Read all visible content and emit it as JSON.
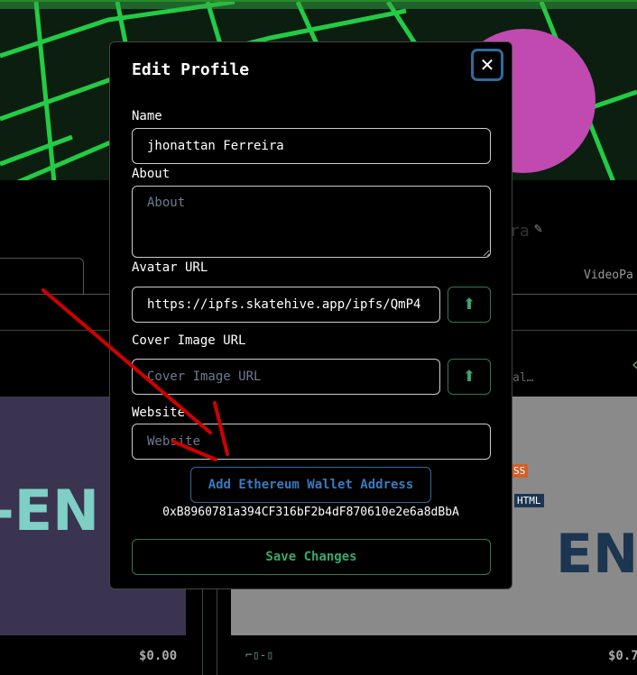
{
  "background": {
    "profile_name_fragment": "ra",
    "tab_label": "VideoPa",
    "card_snippet": "al…",
    "card1_art_text": "-EN",
    "card2_art_text": "END",
    "card2_badges": [
      "SS",
      "HTML"
    ],
    "card1_price": "$0.00",
    "card2_price": "$0.7",
    "card2_icons": "⌐▯-▯"
  },
  "modal": {
    "title": "Edit Profile",
    "close_icon": "close-icon",
    "fields": {
      "name": {
        "label": "Name",
        "value": "jhonattan Ferreira"
      },
      "about": {
        "label": "About",
        "placeholder": "About",
        "value": ""
      },
      "avatar": {
        "label": "Avatar URL",
        "value": "https://ipfs.skatehive.app/ipfs/QmP4"
      },
      "cover": {
        "label": "Cover Image URL",
        "placeholder": "Cover Image URL",
        "value": ""
      },
      "website": {
        "label": "Website",
        "placeholder": "Website",
        "value": ""
      }
    },
    "upload_icon": "upload-icon",
    "eth_button": "Add Ethereum Wallet Address",
    "wallet_address": "0xB8960781a394CF316bF2b4dF870610e2e6a8dBbA",
    "save_button": "Save Changes"
  },
  "colors": {
    "accent_green": "#3aa86a",
    "accent_blue": "#3a7ac0",
    "annotation_red": "#d00000"
  }
}
